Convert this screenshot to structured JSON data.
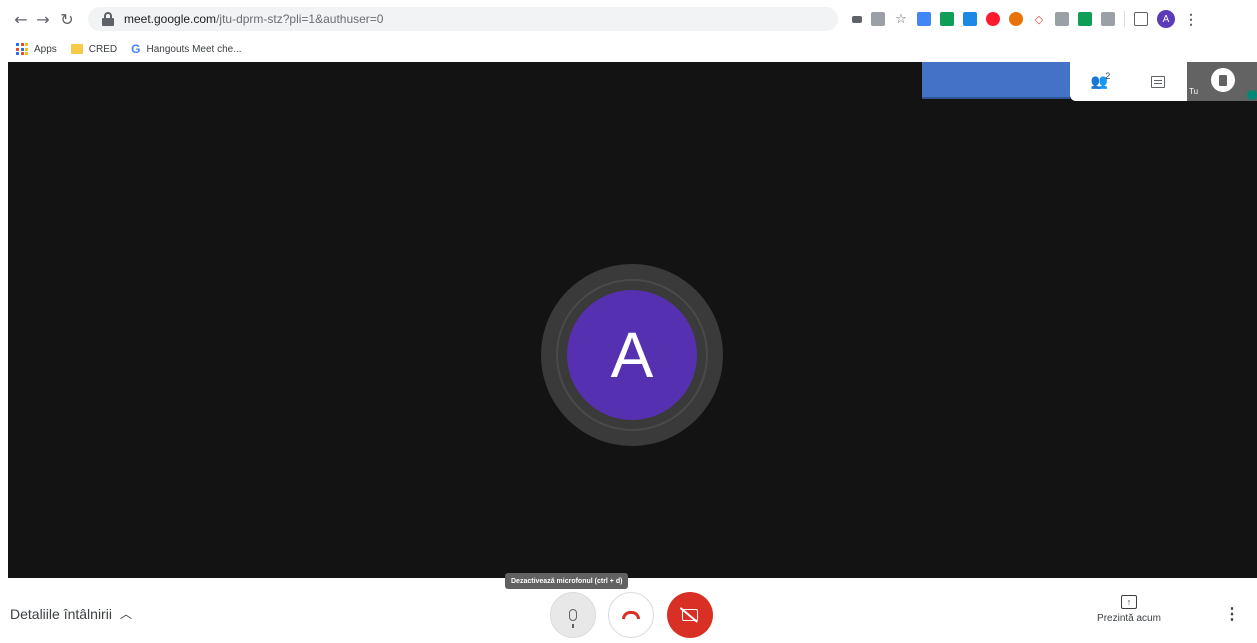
{
  "browser": {
    "url_host": "meet.google.com",
    "url_path": "/jtu-dprm-stz?pli=1&authuser=0",
    "profile_initial": "A",
    "icons": [
      "back-arrow-icon",
      "forward-arrow-icon",
      "reload-icon",
      "lock-icon",
      "camera-icon",
      "translate-icon",
      "star-icon",
      "cast-icon",
      "kebab-menu-icon"
    ]
  },
  "bookmarks": [
    {
      "label": "Apps",
      "icon": "apps-grid-icon"
    },
    {
      "label": "CRED",
      "icon": "folder-icon"
    },
    {
      "label": "Hangouts Meet che...",
      "icon": "google-g-icon"
    }
  ],
  "meeting": {
    "participant_initial": "A",
    "participant_count": "2",
    "self_label": "Tu",
    "avatar_color": "#5530b0",
    "self_tile_color": "#4472c4"
  },
  "controls": {
    "details_label": "Detaliile întâlnirii",
    "mic_tooltip": "Dezactivează microfonul (ctrl + d)",
    "present_label": "Prezintă acum",
    "camera_off_color": "#d93025"
  }
}
